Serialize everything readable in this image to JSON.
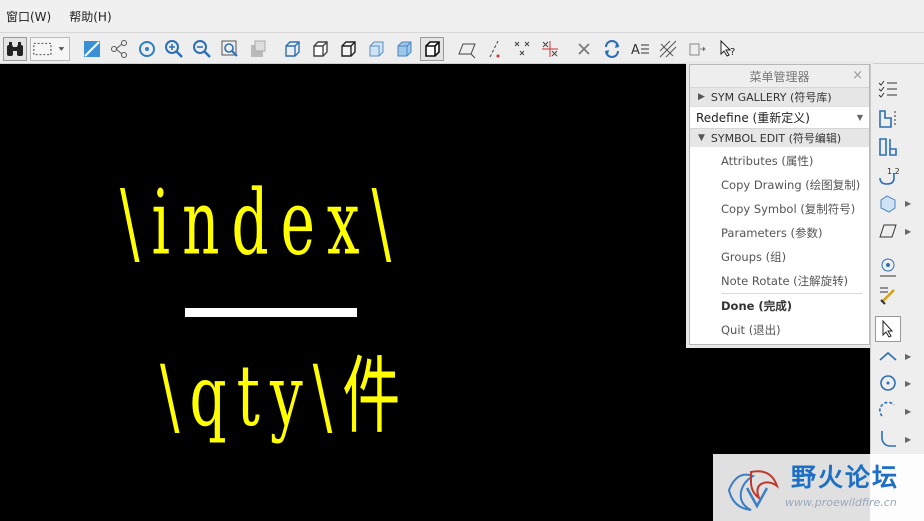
{
  "menubar": {
    "items": [
      "窗口(W)",
      "帮助(H)"
    ]
  },
  "canvas": {
    "symbol_line1": "\\index\\",
    "symbol_line2": "\\qty\\件",
    "text_color": "#ffff00",
    "background": "#000000"
  },
  "menu_manager": {
    "title": "菜单管理器",
    "close": "×",
    "sym_gallery": "SYM GALLERY (符号库)",
    "redefine": "Redefine (重新定义)",
    "symbol_edit": "SYMBOL EDIT (符号编辑)",
    "items": [
      "Attributes (属性)",
      "Copy Drawing (绘图复制)",
      "Copy Symbol (复制符号)",
      "Parameters (参数)",
      "Groups (组)",
      "Note Rotate (注解旋转)"
    ],
    "done": "Done (完成)",
    "quit": "Quit (退出)"
  },
  "watermark": {
    "text": "野火论坛",
    "url": "www.proewildfire.cn"
  },
  "colors": {
    "accent": "#1c6fc5",
    "toolbar_bg": "#eeeeee"
  }
}
